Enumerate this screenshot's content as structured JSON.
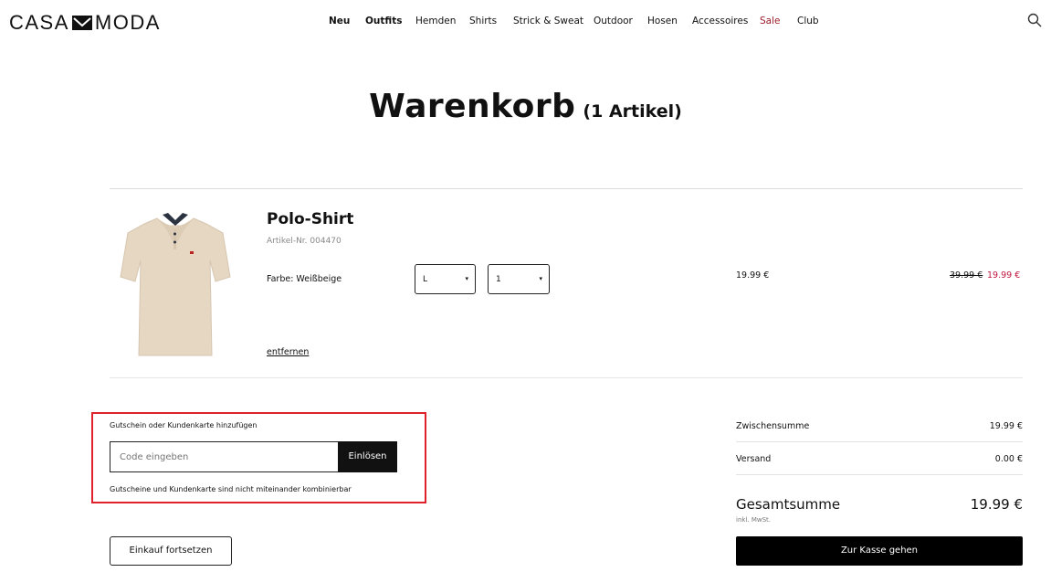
{
  "brand": {
    "name_left": "CASA",
    "name_right": "MODA"
  },
  "nav": [
    {
      "label": "Neu"
    },
    {
      "label": "Outfits"
    },
    {
      "label": "Hemden"
    },
    {
      "label": "Shirts"
    },
    {
      "label": "Strick & Sweat"
    },
    {
      "label": "Outdoor"
    },
    {
      "label": "Hosen"
    },
    {
      "label": "Accessoires"
    },
    {
      "label": "Sale"
    },
    {
      "label": "Club"
    }
  ],
  "icons": {
    "search": "search-icon",
    "logo_mark": "envelope-logo-icon"
  },
  "page": {
    "title": "Warenkorb",
    "count": "(1 Artikel)"
  },
  "item": {
    "name": "Polo-Shirt",
    "article_no": "Artikel-Nr. 004470",
    "color": "Farbe: Weißbeige",
    "size": "L",
    "quantity": "1",
    "unit_price": "19.99 €",
    "old_price": "39.99 €",
    "new_price": "19.99 €",
    "remove": "entfernen"
  },
  "voucher": {
    "label": "Gutschein oder Kundenkarte hinzufügen",
    "placeholder": "Code eingeben",
    "button": "Einlösen",
    "note": "Gutscheine und Kundenkarte sind nicht miteinander kombinierbar"
  },
  "summary": {
    "subtotal_label": "Zwischensumme",
    "subtotal": "19.99 €",
    "shipping_label": "Versand",
    "shipping": "0.00 €",
    "total_label": "Gesamtsumme",
    "total": "19.99 €",
    "tax_note": "inkl. MwSt."
  },
  "actions": {
    "continue": "Einkauf fortsetzen",
    "checkout": "Zur Kasse gehen"
  },
  "colors": {
    "sale": "#9b1c2a",
    "price_red": "#c0143c",
    "highlight": "#e0202b",
    "beige": "#e6d7c3"
  }
}
